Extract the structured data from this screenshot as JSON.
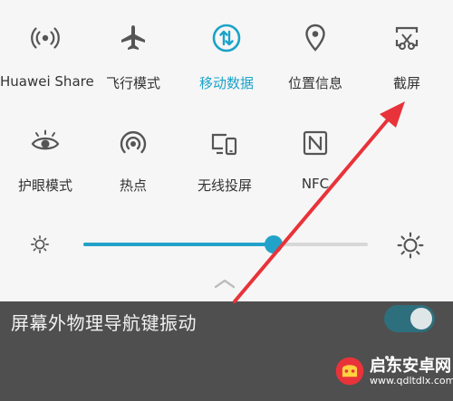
{
  "quick_settings": {
    "tiles": [
      {
        "label": "Huawei Share",
        "icon": "huawei-share-icon",
        "active": false
      },
      {
        "label": "飞行模式",
        "icon": "airplane-icon",
        "active": false
      },
      {
        "label": "移动数据",
        "icon": "mobile-data-icon",
        "active": true
      },
      {
        "label": "位置信息",
        "icon": "location-icon",
        "active": false
      },
      {
        "label": "截屏",
        "icon": "screenshot-icon",
        "active": false
      },
      {
        "label": "护眼模式",
        "icon": "eye-icon",
        "active": false
      },
      {
        "label": "热点",
        "icon": "hotspot-icon",
        "active": false
      },
      {
        "label": "无线投屏",
        "icon": "wireless-projection-icon",
        "active": false
      },
      {
        "label": "NFC",
        "icon": "nfc-icon",
        "active": false
      }
    ]
  },
  "brightness": {
    "level": 0.67,
    "low_icon": "brightness-low-icon",
    "high_icon": "brightness-high-icon"
  },
  "colors": {
    "accent": "#22a2c9",
    "dark_bar": "#4f4f4f",
    "annotation_arrow": "#e8333a"
  },
  "settings_row": {
    "label": "屏幕外物理导航键振动",
    "toggle_on": true
  },
  "watermark": {
    "brand": "启东安卓网",
    "url": "www.qdltdlx.com"
  }
}
